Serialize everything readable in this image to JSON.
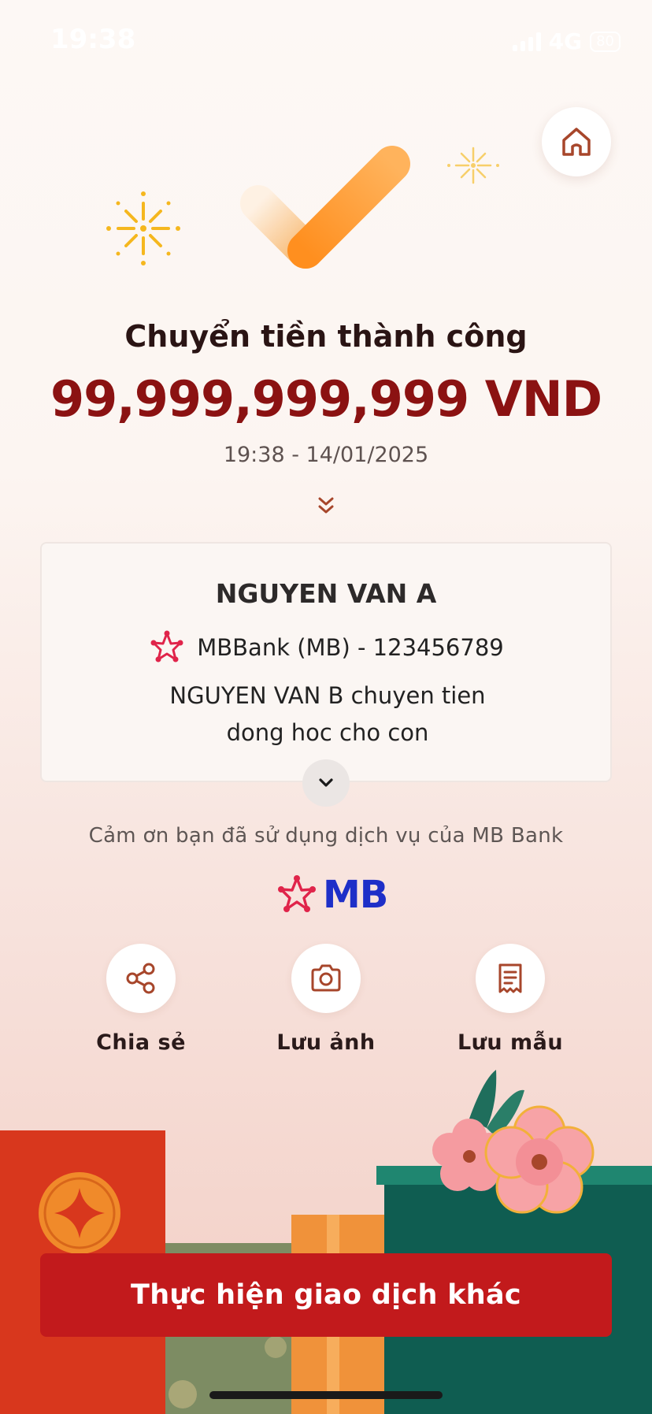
{
  "status_bar": {
    "time": "19:38",
    "network": "4G",
    "battery": "80"
  },
  "result": {
    "title": "Chuyển tiền thành công",
    "amount": "99,999,999,999 VND",
    "datetime": "19:38 - 14/01/2025"
  },
  "transfer": {
    "recipient_name": "NGUYEN VAN A",
    "bank_account": "MBBank (MB) - 123456789",
    "memo": "NGUYEN VAN B chuyen tien dong hoc cho con"
  },
  "thanks_text": "Cảm ơn bạn đã sử dụng dịch vụ của MB Bank",
  "brand": {
    "logo_text": "MB",
    "logo_color": "#1e2fc8",
    "star_color": "#e0244a"
  },
  "actions": [
    {
      "label": "Chia sẻ",
      "icon": "share-icon"
    },
    {
      "label": "Lưu ảnh",
      "icon": "camera-icon"
    },
    {
      "label": "Lưu mẫu",
      "icon": "receipt-icon"
    }
  ],
  "cta": {
    "label": "Thực hiện giao dịch khác"
  },
  "colors": {
    "accent_red": "#c21a1c",
    "amount_red": "#8b1212",
    "icon_brown": "#a7462b",
    "check_orange": "#ff9a2e"
  }
}
